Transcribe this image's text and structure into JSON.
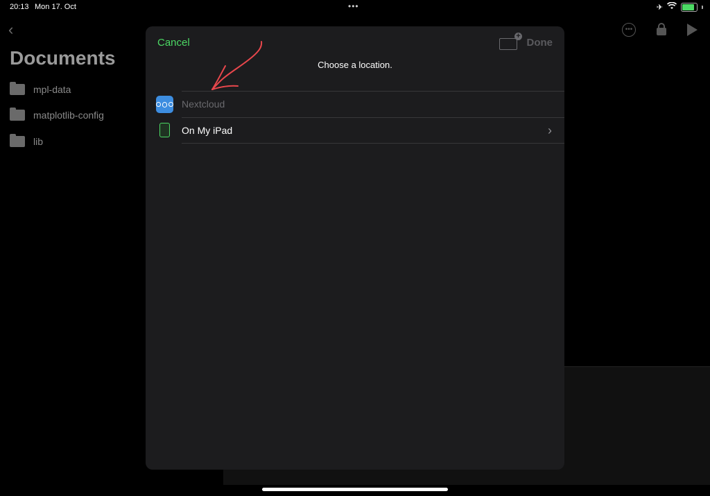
{
  "status_bar": {
    "time": "20:13",
    "date": "Mon 17. Oct",
    "dots": "•••",
    "battery_level": 0.75
  },
  "background_app": {
    "title": "Documents",
    "files": [
      "mpl-data",
      "matplotlib-config",
      "lib"
    ]
  },
  "sheet": {
    "cancel_label": "Cancel",
    "done_label": "Done",
    "subtitle": "Choose a location.",
    "locations": [
      {
        "label": "Nextcloud",
        "icon": "nextcloud-icon",
        "enabled": false
      },
      {
        "label": "On My iPad",
        "icon": "ipad-icon",
        "enabled": true
      }
    ]
  },
  "colors": {
    "accent": "#4cd964",
    "annotation": "#e8474c",
    "sheet_bg": "#1c1c1e"
  }
}
